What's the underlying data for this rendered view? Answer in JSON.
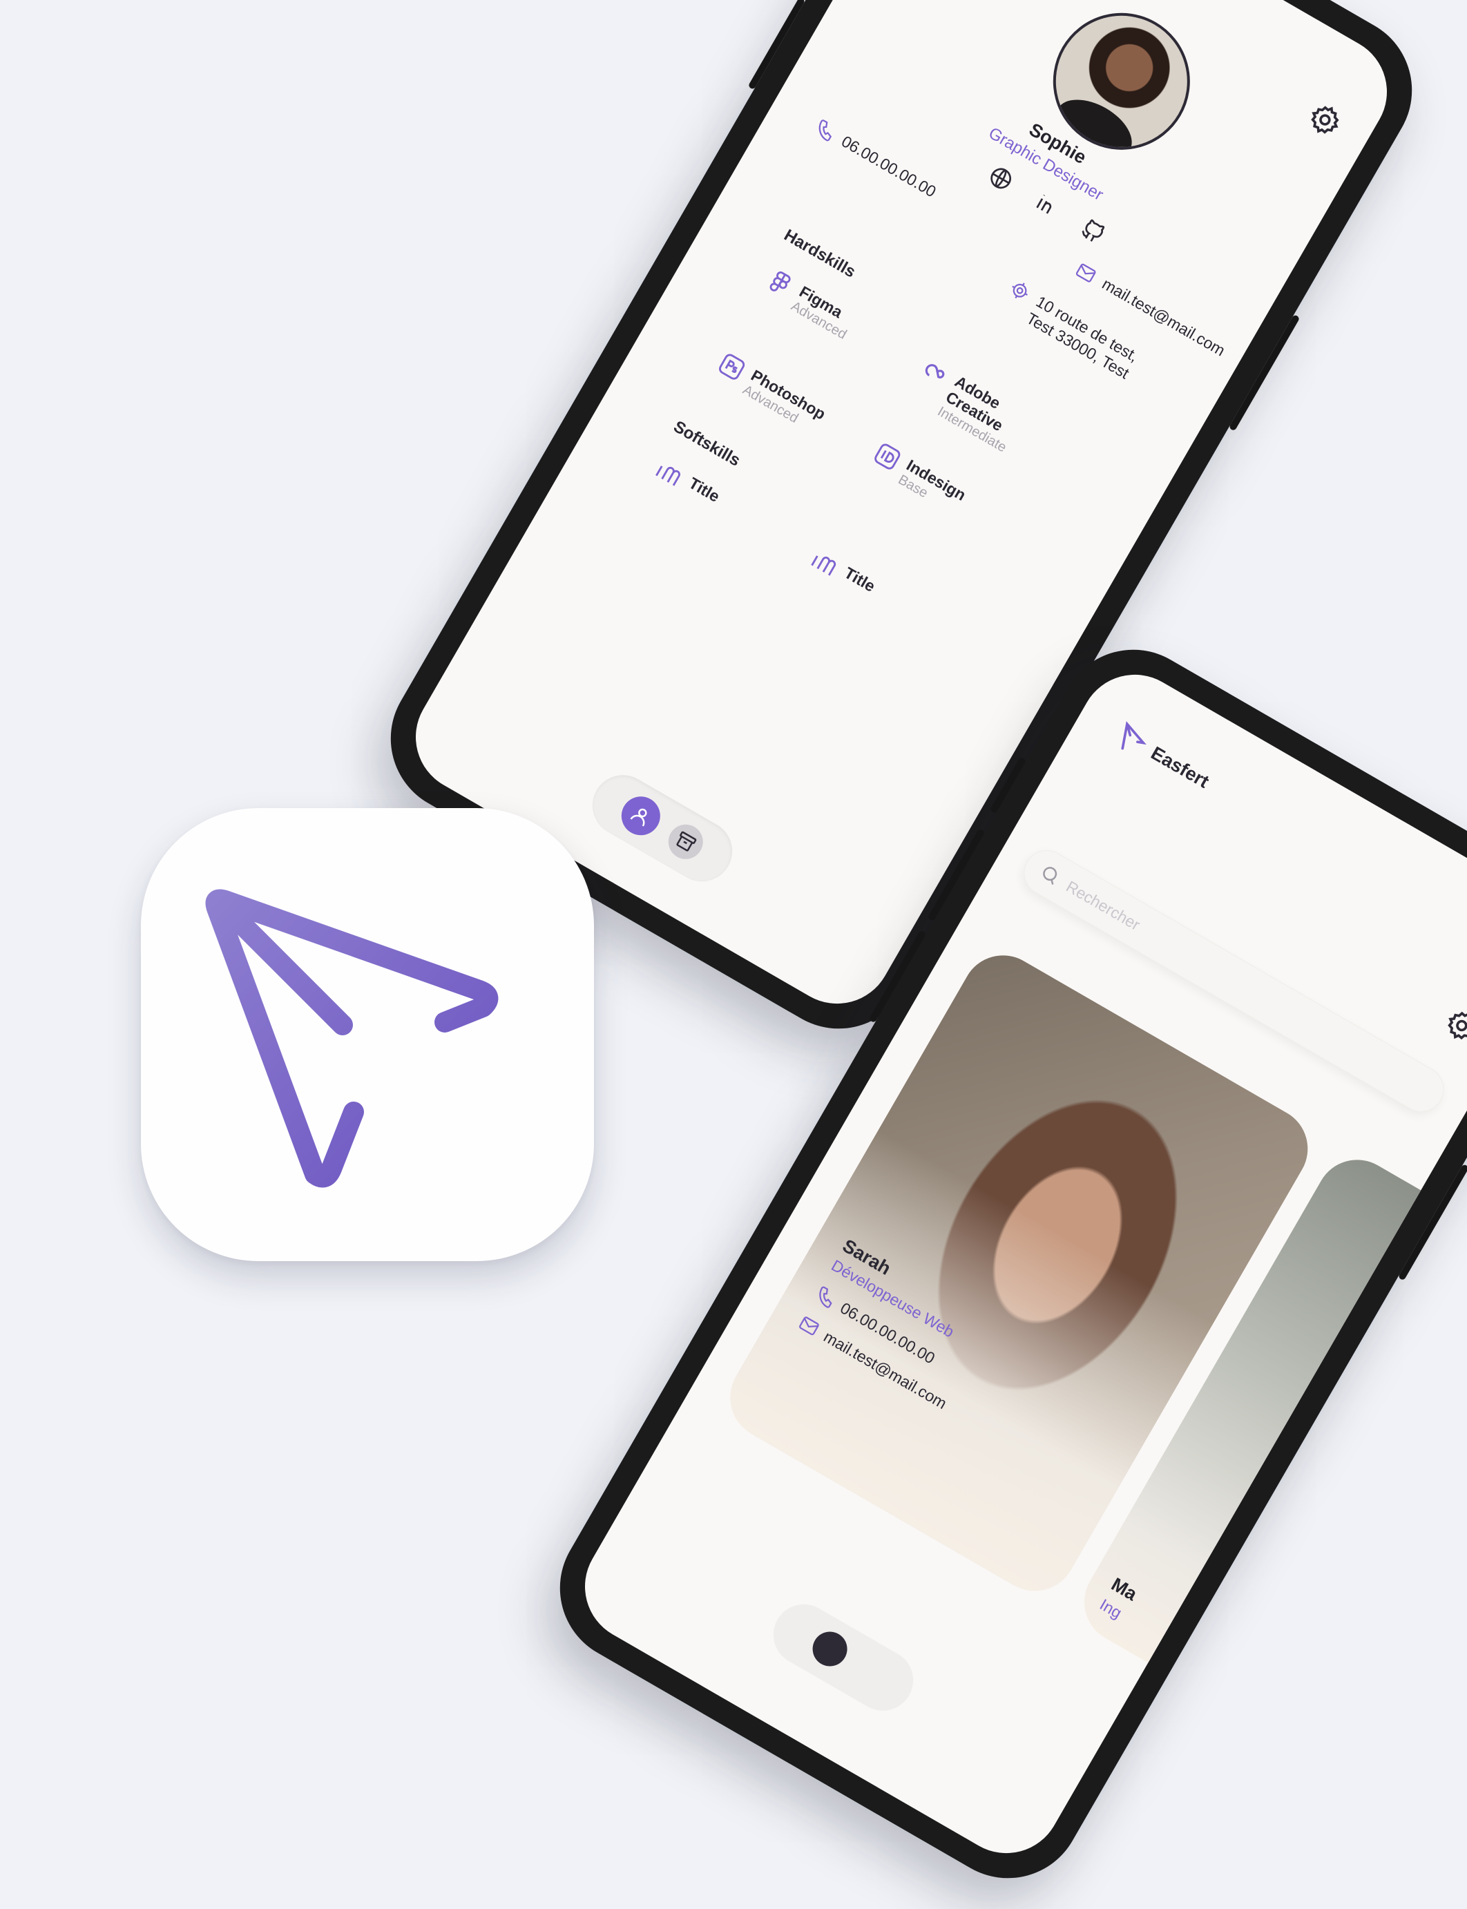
{
  "colors": {
    "accent": "#7d63d1",
    "background": "#f0f2f7",
    "screen": "#faf8f6",
    "phone_frame": "#1b1b1c"
  },
  "profile": {
    "name": "Sophie",
    "role": "Graphic Designer",
    "phone": "06.00.00.00.00",
    "address_line1": "10 route de test,",
    "address_line2": "Test 33000, Test",
    "email": "mail.test@mail.com",
    "social_icons": [
      "globe-icon",
      "linkedin-icon",
      "github-icon"
    ],
    "hardskills_title": "Hardskills",
    "hardskills": [
      {
        "name": "Figma",
        "level": "Advanced",
        "icon": "figma-icon"
      },
      {
        "name": "Photoshop",
        "level": "Advanced",
        "icon": "photoshop-icon"
      },
      {
        "name": "Adobe Creative",
        "level": "Intermediate",
        "icon": "creative-cloud-icon"
      },
      {
        "name": "Indesign",
        "level": "Base",
        "icon": "indesign-icon"
      }
    ],
    "softskills_title": "Softskills",
    "softskills": [
      {
        "name": "Title"
      },
      {
        "name": "Title"
      }
    ],
    "tabs": [
      "profile-icon",
      "archive-icon"
    ]
  },
  "browse": {
    "app_name": "Easfert",
    "search_placeholder": "Rechercher",
    "cards": [
      {
        "name": "Sarah",
        "role": "Développeuse Web",
        "phone": "06.00.00.00.00",
        "email": "mail.test@mail.com"
      },
      {
        "name": "Ma",
        "role": "Ing"
      }
    ]
  }
}
